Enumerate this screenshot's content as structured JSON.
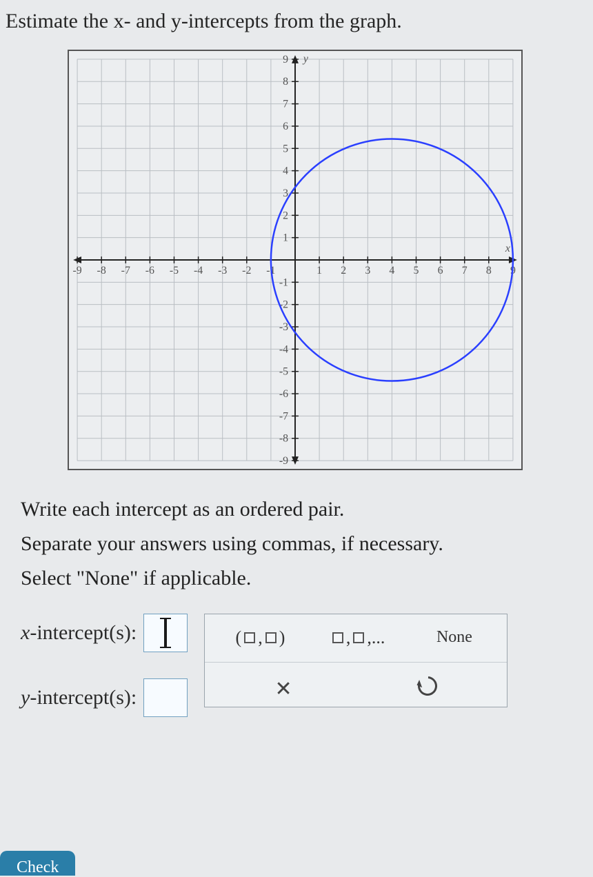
{
  "question": "Estimate the x- and y-intercepts from the graph.",
  "instructions": {
    "line1": "Write each intercept as an ordered pair.",
    "line2": "Separate your answers using commas, if necessary.",
    "line3": "Select \"None\" if applicable."
  },
  "labels": {
    "x_label_prefix": "x",
    "x_label_suffix": "-intercept(s):",
    "y_label_prefix": "y",
    "y_label_suffix": "-intercept(s):"
  },
  "palette": {
    "pair": "(▢,▢)",
    "list": "▢,▢,...",
    "none": "None",
    "close": "✕"
  },
  "answers": {
    "x_intercepts": "",
    "y_intercepts": ""
  },
  "footer": {
    "check": "Check"
  },
  "chart_data": {
    "type": "scatter",
    "title": "",
    "xlabel": "x",
    "ylabel": "y",
    "xlim": [
      -9,
      9
    ],
    "ylim": [
      -9,
      9
    ],
    "x_ticks": [
      -9,
      -8,
      -7,
      -6,
      -5,
      -4,
      -3,
      -2,
      -1,
      1,
      2,
      3,
      4,
      5,
      6,
      7,
      8,
      9
    ],
    "y_ticks": [
      -9,
      -8,
      -7,
      -6,
      -5,
      -4,
      -3,
      -2,
      -1,
      1,
      2,
      3,
      4,
      5,
      6,
      7,
      8,
      9
    ],
    "shapes": [
      {
        "kind": "circle",
        "center": [
          4,
          0
        ],
        "radius": 5,
        "stroke": "#2a3fff"
      }
    ],
    "intercepts_estimated": {
      "x": [
        [
          -1,
          0
        ],
        [
          9,
          0
        ]
      ],
      "y": [
        [
          0,
          -3
        ],
        [
          0,
          3
        ]
      ]
    }
  }
}
